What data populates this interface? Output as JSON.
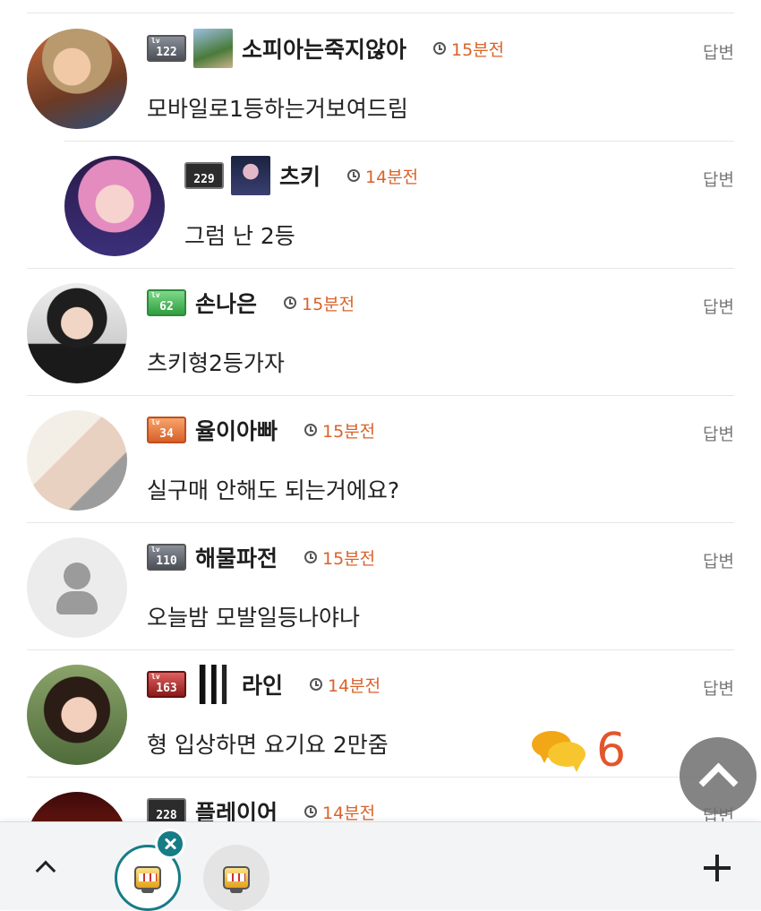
{
  "reply_label": "답변",
  "comments": [
    {
      "level": "122",
      "nickname": "소피아는죽지않아",
      "time": "15분전",
      "text": "모바일로1등하는거보여드림",
      "has_user_image": true,
      "avatar": "anime-character"
    },
    {
      "level": "229",
      "nickname": "츠키",
      "time": "14분전",
      "text": "그럼 난 2등",
      "has_user_image": true,
      "avatar": "pink-hair-person",
      "is_reply": true
    },
    {
      "level": "62",
      "nickname": "손나은",
      "time": "15분전",
      "text": "츠키형2등가자",
      "has_user_image": false,
      "avatar": "person-photo"
    },
    {
      "level": "34",
      "nickname": "율이아빠",
      "time": "15분전",
      "text": "실구매 안해도 되는거에요?",
      "has_user_image": false,
      "avatar": "photo"
    },
    {
      "level": "110",
      "nickname": "해물파전",
      "time": "15분전",
      "text": "오늘밤 모발일등나야나",
      "has_user_image": false,
      "avatar": "default-person-icon"
    },
    {
      "level": "163",
      "nickname": "라인",
      "time": "14분전",
      "text": "형 입상하면 요기요 2만줌",
      "has_user_image": true,
      "avatar": "person-photo"
    },
    {
      "level": "228",
      "nickname": "플레이어",
      "time": "14분전",
      "text": "",
      "has_user_image": false,
      "avatar": "photo"
    }
  ],
  "comment_count": "6",
  "colors": {
    "time": "#d9622a",
    "count": "#e2562b",
    "chat_icon": "#f2a716",
    "tab_accent": "#167c86"
  }
}
